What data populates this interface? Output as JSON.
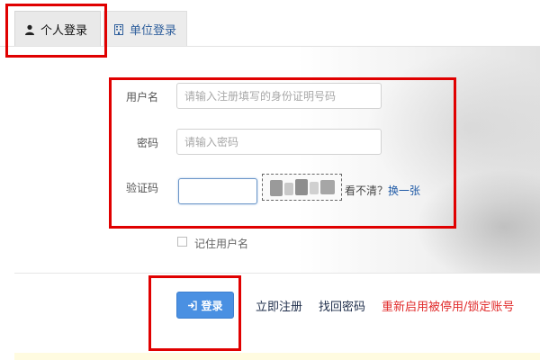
{
  "tabs": [
    {
      "label": "个人登录",
      "active": true
    },
    {
      "label": "单位登录",
      "active": false
    }
  ],
  "form": {
    "username_label": "用户名",
    "username_placeholder": "请输入注册填写的身份证明号码",
    "password_label": "密码",
    "password_placeholder": "请输入密码",
    "captcha_label": "验证码",
    "captcha_value": "",
    "captcha_hint_tail": "看不清？",
    "captcha_refresh": "换一张",
    "remember_label": "记住用户名",
    "remember_checked": false
  },
  "actions": {
    "login_label": "登录",
    "register_label": "立即注册",
    "recover_label": "找回密码",
    "reactivate_label": "重新启用被停用/锁定账号"
  },
  "colors": {
    "primary_button": "#4a90e2",
    "highlight_box": "#e00000",
    "warning_link": "#e02a2a",
    "unit_tab_text": "#2f5f9c"
  },
  "icons": {
    "personal_tab": "user-icon",
    "unit_tab": "building-icon",
    "login_button": "sign-in-icon"
  }
}
